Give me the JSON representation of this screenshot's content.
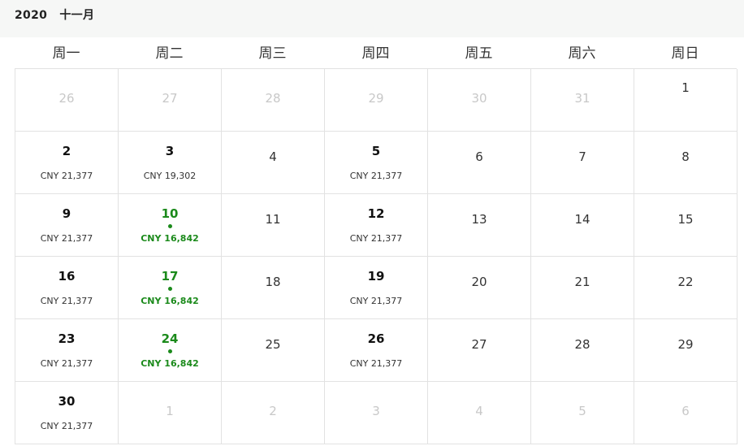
{
  "header": {
    "year": "2020",
    "month": "十一月"
  },
  "weekdays": [
    "周一",
    "周二",
    "周三",
    "周四",
    "周五",
    "周六",
    "周日"
  ],
  "colors": {
    "cheap": "#1b8a1b",
    "muted": "#c8c8c8"
  },
  "weeks": [
    [
      {
        "day": "26",
        "muted": true
      },
      {
        "day": "27",
        "muted": true
      },
      {
        "day": "28",
        "muted": true
      },
      {
        "day": "29",
        "muted": true
      },
      {
        "day": "30",
        "muted": true
      },
      {
        "day": "31",
        "muted": true
      },
      {
        "day": "1"
      }
    ],
    [
      {
        "day": "2",
        "price": "CNY 21,377"
      },
      {
        "day": "3",
        "price": "CNY 19,302"
      },
      {
        "day": "4"
      },
      {
        "day": "5",
        "price": "CNY 21,377"
      },
      {
        "day": "6"
      },
      {
        "day": "7"
      },
      {
        "day": "8"
      }
    ],
    [
      {
        "day": "9",
        "price": "CNY 21,377"
      },
      {
        "day": "10",
        "price": "CNY 16,842",
        "cheap": true
      },
      {
        "day": "11"
      },
      {
        "day": "12",
        "price": "CNY 21,377"
      },
      {
        "day": "13"
      },
      {
        "day": "14"
      },
      {
        "day": "15"
      }
    ],
    [
      {
        "day": "16",
        "price": "CNY 21,377"
      },
      {
        "day": "17",
        "price": "CNY 16,842",
        "cheap": true
      },
      {
        "day": "18"
      },
      {
        "day": "19",
        "price": "CNY 21,377"
      },
      {
        "day": "20"
      },
      {
        "day": "21"
      },
      {
        "day": "22"
      }
    ],
    [
      {
        "day": "23",
        "price": "CNY 21,377"
      },
      {
        "day": "24",
        "price": "CNY 16,842",
        "cheap": true
      },
      {
        "day": "25"
      },
      {
        "day": "26",
        "price": "CNY 21,377"
      },
      {
        "day": "27"
      },
      {
        "day": "28"
      },
      {
        "day": "29"
      }
    ],
    [
      {
        "day": "30",
        "price": "CNY 21,377"
      },
      {
        "day": "1",
        "muted": true
      },
      {
        "day": "2",
        "muted": true
      },
      {
        "day": "3",
        "muted": true
      },
      {
        "day": "4",
        "muted": true
      },
      {
        "day": "5",
        "muted": true
      },
      {
        "day": "6",
        "muted": true
      }
    ]
  ]
}
